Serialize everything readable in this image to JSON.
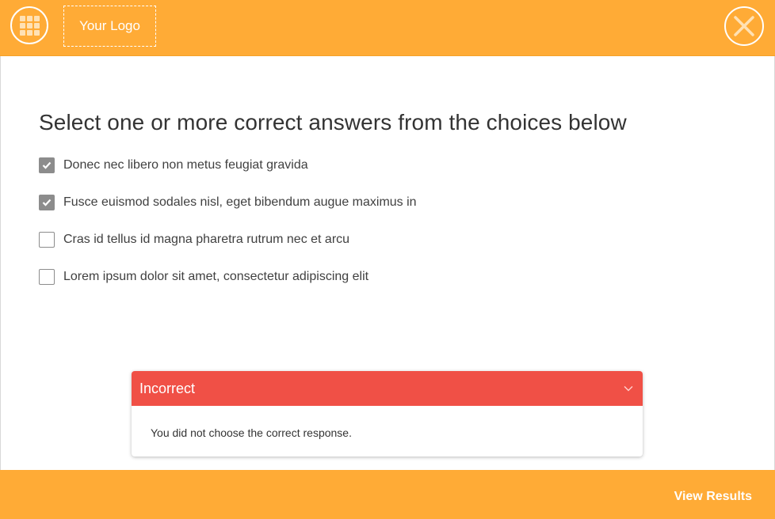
{
  "colors": {
    "accent": "#ffab36",
    "incorrect": "#f05046",
    "checkbox": "#8c8c8c"
  },
  "header": {
    "menu_icon": "grid-icon",
    "logo_text": "Your Logo",
    "close_icon": "close-icon"
  },
  "question": {
    "prompt": "Select one or more correct answers from the choices below",
    "choices": [
      {
        "label": "Donec nec libero non metus feugiat gravida",
        "checked": true
      },
      {
        "label": "Fusce euismod sodales nisl, eget bibendum augue maximus in",
        "checked": true
      },
      {
        "label": "Cras id tellus id magna pharetra rutrum nec et arcu",
        "checked": false
      },
      {
        "label": "Lorem ipsum dolor sit amet, consectetur adipiscing elit",
        "checked": false
      }
    ]
  },
  "feedback": {
    "title": "Incorrect",
    "message": "You did not choose the correct response.",
    "toggle_icon": "chevron-down-icon"
  },
  "footer": {
    "view_results_label": "View Results"
  }
}
